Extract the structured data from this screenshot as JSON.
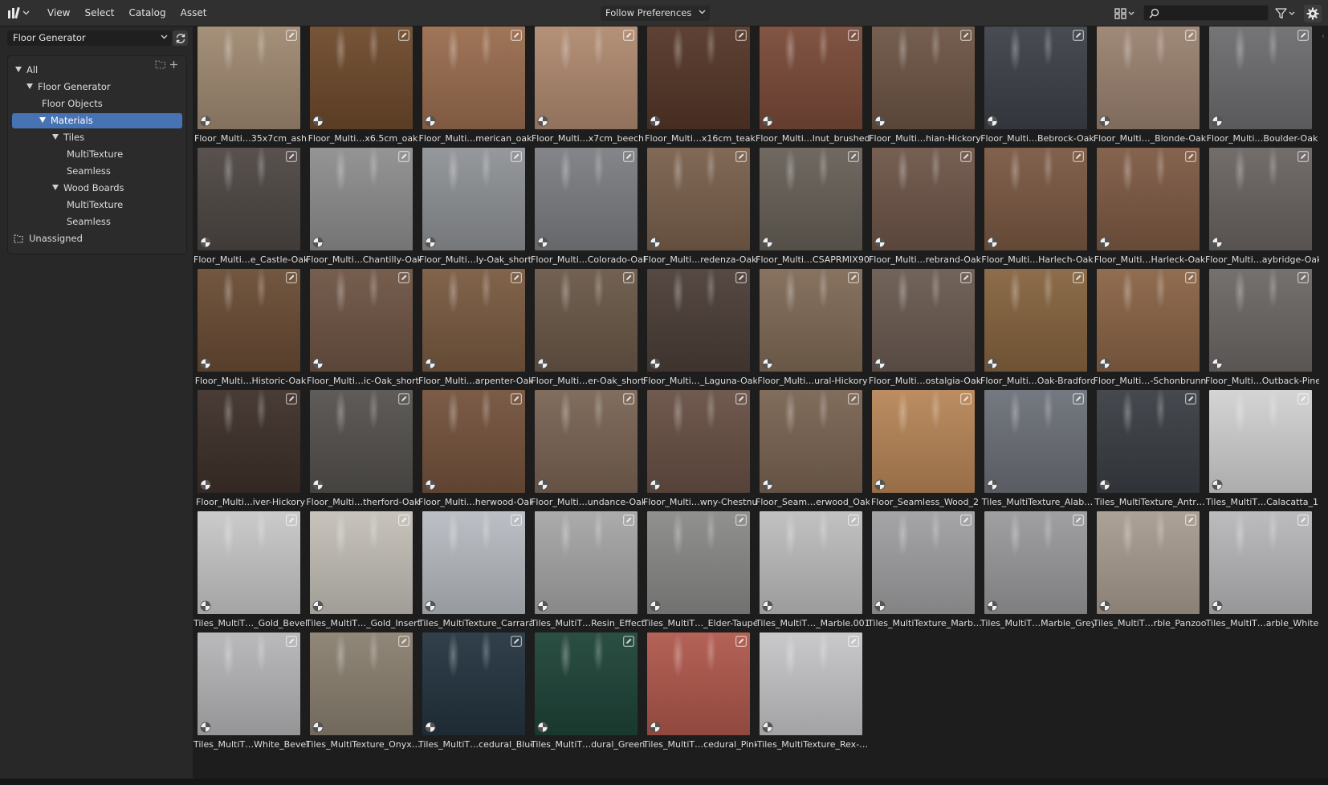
{
  "header": {
    "menus": [
      "View",
      "Select",
      "Catalog",
      "Asset"
    ],
    "import_method": "Follow Preferences",
    "search": {
      "value": "",
      "placeholder": ""
    },
    "icons": [
      "editor-type-asset-browser-icon",
      "display-mode-grid-icon",
      "search-icon",
      "filter-icon",
      "gear-icon"
    ]
  },
  "sidebar": {
    "library": "Floor Generator",
    "catalogs": [
      {
        "label": "All",
        "level": 0,
        "expanded": true
      },
      {
        "label": "Floor Generator",
        "level": 1,
        "expanded": true
      },
      {
        "label": "Floor Objects",
        "level": 2
      },
      {
        "label": "Materials",
        "level": 2,
        "expanded": true,
        "selected": true
      },
      {
        "label": "Tiles",
        "level": 3,
        "expanded": true
      },
      {
        "label": "MultiTexture",
        "level": 4
      },
      {
        "label": "Seamless",
        "level": 4
      },
      {
        "label": "Wood Boards",
        "level": 3,
        "expanded": true
      },
      {
        "label": "MultiTexture",
        "level": 4
      },
      {
        "label": "Seamless",
        "level": 4
      }
    ],
    "unassigned": "Unassigned"
  },
  "assets": [
    {
      "name": "Floor_Multi…35x7cm_ash",
      "color": "#a08a72"
    },
    {
      "name": "Floor_Multi…x6.5cm_oak",
      "color": "#6e4a2c"
    },
    {
      "name": "Floor_Multi…merican_oak",
      "color": "#9a6d4f"
    },
    {
      "name": "Floor_Multi…x7cm_beech",
      "color": "#b08a70"
    },
    {
      "name": "Floor_Multi…x16cm_teak",
      "color": "#553628"
    },
    {
      "name": "Floor_Multi…lnut_brushed",
      "color": "#7a4a38"
    },
    {
      "name": "Floor_Multi…hian-Hickory",
      "color": "#6d5545"
    },
    {
      "name": "Floor_Multi…Bebrock-Oak",
      "color": "#3d4148"
    },
    {
      "name": "Floor_Multi…_Blonde-Oak",
      "color": "#9a8270"
    },
    {
      "name": "Floor_Multi…Boulder-Oak",
      "color": "#6d6d70"
    },
    {
      "name": "Floor_Multi…e_Castle-Oak",
      "color": "#4e4744"
    },
    {
      "name": "Floor_Multi…Chantilly-Oak",
      "color": "#8e8e8e"
    },
    {
      "name": "Floor_Multi…ly-Oak_short",
      "color": "#8f9296"
    },
    {
      "name": "Floor_Multi…Colorado-Oak",
      "color": "#7c7e82"
    },
    {
      "name": "Floor_Multi…redenza-Oak",
      "color": "#7a604c"
    },
    {
      "name": "Floor_Multi…CSAPRMIX90",
      "color": "#676058"
    },
    {
      "name": "Floor_Multi…rebrand-Oak",
      "color": "#6e5548"
    },
    {
      "name": "Floor_Multi…Harlech-Oak",
      "color": "#7a5842"
    },
    {
      "name": "Floor_Multi…Harleck-Oak",
      "color": "#7e5a44"
    },
    {
      "name": "Floor_Multi…aybridge-Oak",
      "color": "#6a6462"
    },
    {
      "name": "Floor_Multi…Historic-Oak",
      "color": "#6a4c34"
    },
    {
      "name": "Floor_Multi…ic-Oak_short",
      "color": "#6e5444"
    },
    {
      "name": "Floor_Multi…arpenter-Oak",
      "color": "#7a5a40"
    },
    {
      "name": "Floor_Multi…er-Oak_short",
      "color": "#6a5848"
    },
    {
      "name": "Floor_Multi…_Laguna-Oak",
      "color": "#4c3e38"
    },
    {
      "name": "Floor_Multi…ural-Hickory",
      "color": "#806a56"
    },
    {
      "name": "Floor_Multi…ostalgia-Oak",
      "color": "#6a5a50"
    },
    {
      "name": "Floor_Multi…Oak-Bradford",
      "color": "#86643f"
    },
    {
      "name": "Floor_Multi…-Schonbrunn",
      "color": "#8a6446"
    },
    {
      "name": "Floor_Multi…Outback-Pine",
      "color": "#6c6866"
    },
    {
      "name": "Floor_Multi…iver-Hickory",
      "color": "#3e302a"
    },
    {
      "name": "Floor_Multi…therford-Oak",
      "color": "#54514e"
    },
    {
      "name": "Floor_Multi…herwood-Oak",
      "color": "#74523c"
    },
    {
      "name": "Floor_Multi…undance-Oak",
      "color": "#7a6454"
    },
    {
      "name": "Floor_Multi…wny-Chestnut",
      "color": "#685044"
    },
    {
      "name": "Floor_Seam…erwood_Oak",
      "color": "#7a6452"
    },
    {
      "name": "Floor_Seamless_Wood_2",
      "color": "#b88658"
    },
    {
      "name": "Tiles_MultiTexture_Alab…",
      "color": "#6c7078"
    },
    {
      "name": "Tiles_MultiTexture_Antr…",
      "color": "#3a3e44"
    },
    {
      "name": "Tiles_MultiT…Calacatta_1",
      "color": "#d2d2d2"
    },
    {
      "name": "Tiles_MultiT…_Gold_Bevel",
      "color": "#c8c8c8"
    },
    {
      "name": "Tiles_MultiT…_Gold_Insert",
      "color": "#c4c0b8"
    },
    {
      "name": "Tiles_MultiTexture_Carrara",
      "color": "#b8bcc2"
    },
    {
      "name": "Tiles_MultiT…Resin_Effect",
      "color": "#a6a6a6"
    },
    {
      "name": "Tiles_MultiT…_Elder-Taupe",
      "color": "#8a8a88"
    },
    {
      "name": "Tiles_MultiT…_Marble.001",
      "color": "#bebebe"
    },
    {
      "name": "Tiles_MultiTexture_Marb…",
      "color": "#a0a0a2"
    },
    {
      "name": "Tiles_MultiT…Marble_Grey",
      "color": "#9a9a9c"
    },
    {
      "name": "Tiles_MultiT…rble_Panzoo",
      "color": "#a89c90"
    },
    {
      "name": "Tiles_MultiT…arble_White",
      "color": "#b8b8ba"
    },
    {
      "name": "Tiles_MultiT…White_Bevel",
      "color": "#b6b6b8"
    },
    {
      "name": "Tiles_MultiTexture_Onyx…",
      "color": "#8a8070"
    },
    {
      "name": "Tiles_MultiT…cedural_Blue",
      "color": "#243440"
    },
    {
      "name": "Tiles_MultiT…dural_Green",
      "color": "#1e4438"
    },
    {
      "name": "Tiles_MultiT…cedural_Pink",
      "color": "#b0584c"
    },
    {
      "name": "Tiles_MultiTexture_Rex-…",
      "color": "#c6c6c8"
    }
  ]
}
